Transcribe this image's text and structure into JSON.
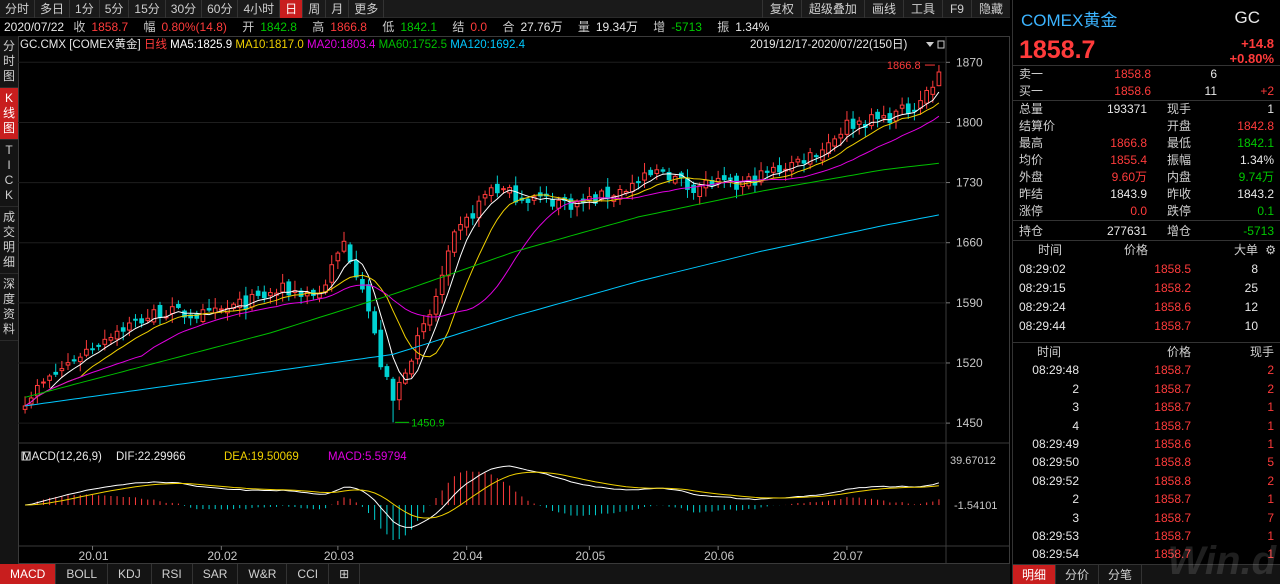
{
  "topbar": {
    "periods": [
      "分时",
      "多日",
      "1分",
      "5分",
      "15分",
      "30分",
      "60分",
      "4小时",
      "日",
      "周",
      "月",
      "更多"
    ],
    "active_period": "日",
    "tools": [
      "复权",
      "超级叠加",
      "画线",
      "工具",
      "F9",
      "隐藏"
    ]
  },
  "infobar": {
    "date": "2020/07/22",
    "close_label": "收",
    "close_value": "1858.7",
    "change_label": "幅",
    "change_value": "0.80%(14.8)",
    "open_label": "开",
    "open_value": "1842.8",
    "high_label": "高",
    "high_value": "1866.8",
    "low_label": "低",
    "low_value": "1842.1",
    "settle_label": "结",
    "settle_value": "0.0",
    "amount_label": "合",
    "amount_value": "27.76万",
    "volume_label": "量",
    "volume_value": "19.34万",
    "oi_change_label": "增",
    "oi_change_value": "-5713",
    "amplitude_label": "振",
    "amplitude_value": "1.34%"
  },
  "left_tabs": [
    "分\n时\n图",
    "K\n线\n图",
    "T\nI\nC\nK",
    "成\n交\n明\n细",
    "深\n度\n资\n料"
  ],
  "chart_data": [
    {
      "type": "candlestick",
      "instrument": "GC.CMX [COMEX黄金]",
      "period_label": "日线",
      "range_label": "2019/12/17-2020/07/22(150日)",
      "indicators": [
        {
          "name": "MA5",
          "value": "1825.9",
          "color": "#ffffff"
        },
        {
          "name": "MA10",
          "value": "1817.0",
          "color": "#f0d000"
        },
        {
          "name": "MA20",
          "value": "1803.4",
          "color": "#e000e0"
        },
        {
          "name": "MA60",
          "value": "1752.5",
          "color": "#00c000"
        },
        {
          "name": "MA120",
          "value": "1692.4",
          "color": "#00c8ff"
        }
      ],
      "y_ticks": [
        1450,
        1520,
        1590,
        1660,
        1730,
        1800,
        1870
      ],
      "ylim": [
        1428,
        1882
      ],
      "x_labels": [
        {
          "label": "20.01",
          "index": 11
        },
        {
          "label": "20.02",
          "index": 32
        },
        {
          "label": "20.03",
          "index": 51
        },
        {
          "label": "20.04",
          "index": 72
        },
        {
          "label": "20.05",
          "index": 92
        },
        {
          "label": "20.06",
          "index": 113
        },
        {
          "label": "20.07",
          "index": 134
        }
      ],
      "n_days": 150,
      "max_label": "1866.8",
      "min_label": "1450.9",
      "anchors": [
        [
          0,
          1478
        ],
        [
          8,
          1525
        ],
        [
          14,
          1555
        ],
        [
          22,
          1580
        ],
        [
          30,
          1575
        ],
        [
          36,
          1590
        ],
        [
          42,
          1605
        ],
        [
          48,
          1600
        ],
        [
          52,
          1660
        ],
        [
          55,
          1612
        ],
        [
          58,
          1520
        ],
        [
          60,
          1475
        ],
        [
          62,
          1515
        ],
        [
          66,
          1575
        ],
        [
          70,
          1665
        ],
        [
          73,
          1695
        ],
        [
          76,
          1725
        ],
        [
          80,
          1715
        ],
        [
          85,
          1710
        ],
        [
          90,
          1705
        ],
        [
          95,
          1715
        ],
        [
          100,
          1730
        ],
        [
          104,
          1745
        ],
        [
          108,
          1725
        ],
        [
          112,
          1730
        ],
        [
          116,
          1725
        ],
        [
          120,
          1738
        ],
        [
          126,
          1755
        ],
        [
          130,
          1770
        ],
        [
          134,
          1798
        ],
        [
          140,
          1805
        ],
        [
          144,
          1815
        ],
        [
          148,
          1842
        ],
        [
          149,
          1858.7
        ]
      ],
      "ma60_anchors": [
        [
          0,
          1480
        ],
        [
          40,
          1555
        ],
        [
          60,
          1600
        ],
        [
          80,
          1650
        ],
        [
          100,
          1690
        ],
        [
          120,
          1720
        ],
        [
          140,
          1745
        ],
        [
          149,
          1752.5
        ]
      ],
      "ma120_anchors": [
        [
          0,
          1470
        ],
        [
          60,
          1530
        ],
        [
          80,
          1575
        ],
        [
          100,
          1615
        ],
        [
          120,
          1650
        ],
        [
          140,
          1680
        ],
        [
          149,
          1692.4
        ]
      ]
    },
    {
      "type": "macd",
      "label": "MACD(12,26,9)",
      "dif_label": "DIF:22.29966",
      "dea_label": "DEA:19.50069",
      "macd_label": "MACD:5.59794",
      "y_top_label": "39.67012",
      "y_bottom_label": "-1.54101"
    }
  ],
  "bottom_tabs": [
    "MACD",
    "BOLL",
    "KDJ",
    "RSI",
    "SAR",
    "W&R",
    "CCI"
  ],
  "bottom_active": "MACD",
  "right_panel": {
    "name": "COMEX黄金",
    "code": "GC",
    "last": "1858.7",
    "change": "+14.8",
    "change_pct": "+0.80%",
    "orderbook": [
      {
        "label": "卖一",
        "price": "1858.8",
        "vol": "6",
        "chg": ""
      },
      {
        "label": "买一",
        "price": "1858.6",
        "vol": "11",
        "chg": "+2"
      }
    ],
    "stats": [
      {
        "k1": "总量",
        "v1": "193371",
        "k2": "现手",
        "v2": "1",
        "c1": "white",
        "c2": "white"
      },
      {
        "k1": "结算价",
        "v1": "",
        "k2": "开盘",
        "v2": "1842.8",
        "c1": "white",
        "c2": "red"
      },
      {
        "k1": "最高",
        "v1": "1866.8",
        "k2": "最低",
        "v2": "1842.1",
        "c1": "red",
        "c2": "green"
      },
      {
        "k1": "均价",
        "v1": "1855.4",
        "k2": "振幅",
        "v2": "1.34%",
        "c1": "red",
        "c2": "white"
      },
      {
        "k1": "外盘",
        "v1": "9.60万",
        "k2": "内盘",
        "v2": "9.74万",
        "c1": "red",
        "c2": "green"
      },
      {
        "k1": "昨结",
        "v1": "1843.9",
        "k2": "昨收",
        "v2": "1843.2",
        "c1": "white",
        "c2": "white"
      },
      {
        "k1": "涨停",
        "v1": "0.0",
        "k2": "跌停",
        "v2": "0.1",
        "c1": "red",
        "c2": "green"
      }
    ],
    "oi": {
      "k1": "持仓",
      "v1": "277631",
      "k2": "增仓",
      "v2": "-5713"
    },
    "big_trades_header": [
      "时间",
      "价格",
      "大单"
    ],
    "big_trades": [
      {
        "time": "08:29:02",
        "price": "1858.5",
        "vol": "8"
      },
      {
        "time": "08:29:15",
        "price": "1858.2",
        "vol": "25"
      },
      {
        "time": "08:29:24",
        "price": "1858.6",
        "vol": "12"
      },
      {
        "time": "08:29:44",
        "price": "1858.7",
        "vol": "10"
      }
    ],
    "ticks_header": [
      "时间",
      "价格",
      "现手"
    ],
    "ticks": [
      {
        "time": "08:29:48",
        "price": "1858.7",
        "vol": "2",
        "up": true
      },
      {
        "time": "2",
        "price": "1858.7",
        "vol": "2",
        "up": true
      },
      {
        "time": "3",
        "price": "1858.7",
        "vol": "1",
        "up": true
      },
      {
        "time": "4",
        "price": "1858.7",
        "vol": "1",
        "up": true
      },
      {
        "time": "08:29:49",
        "price": "1858.6",
        "vol": "1",
        "up": true
      },
      {
        "time": "08:29:50",
        "price": "1858.8",
        "vol": "5",
        "up": true
      },
      {
        "time": "08:29:52",
        "price": "1858.8",
        "vol": "2",
        "up": true
      },
      {
        "time": "2",
        "price": "1858.7",
        "vol": "1",
        "up": true
      },
      {
        "time": "3",
        "price": "1858.7",
        "vol": "7",
        "up": true
      },
      {
        "time": "08:29:53",
        "price": "1858.7",
        "vol": "1",
        "up": true
      },
      {
        "time": "08:29:54",
        "price": "1858.7",
        "vol": "1",
        "up": true
      }
    ],
    "bottom_tabs": [
      "明细",
      "分价",
      "分笔"
    ],
    "bottom_active": "明细",
    "watermark": "Win.d"
  }
}
